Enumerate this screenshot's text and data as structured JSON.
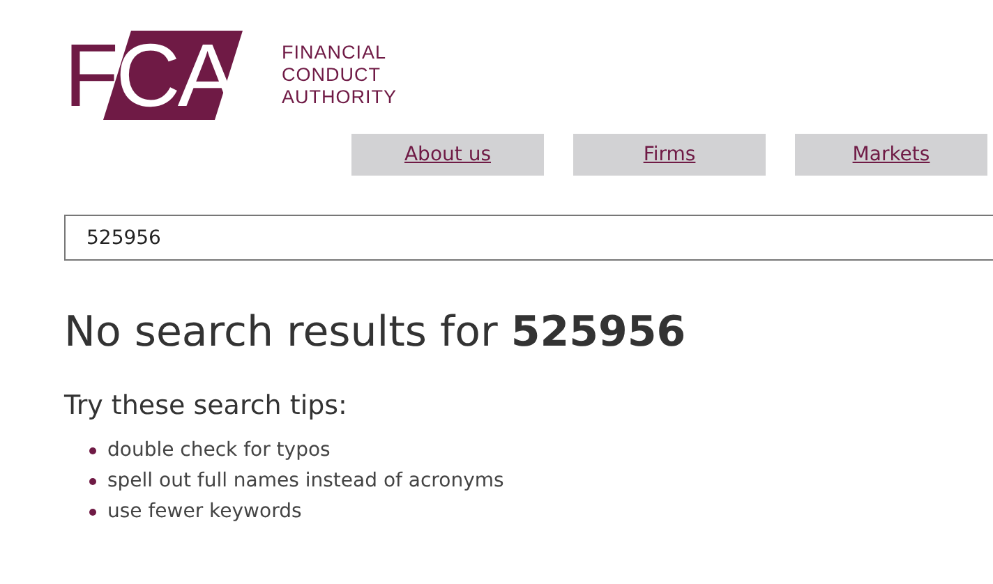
{
  "logo": {
    "letters": [
      {
        "text": "F",
        "kind": "plain"
      },
      {
        "text": "C",
        "kind": "reversed"
      },
      {
        "text": "A",
        "kind": "reversed"
      }
    ],
    "name_lines": [
      "FINANCIAL",
      "CONDUCT",
      "AUTHORITY"
    ]
  },
  "nav": [
    {
      "label": "About us"
    },
    {
      "label": "Firms"
    },
    {
      "label": "Markets"
    }
  ],
  "search": {
    "value": "525956"
  },
  "heading": {
    "text": "No search results for ",
    "query": "525956"
  },
  "tips_title": "Try these search tips:",
  "tips": [
    "double check for typos",
    "spell out full names instead of acronyms",
    "use fewer keywords"
  ]
}
